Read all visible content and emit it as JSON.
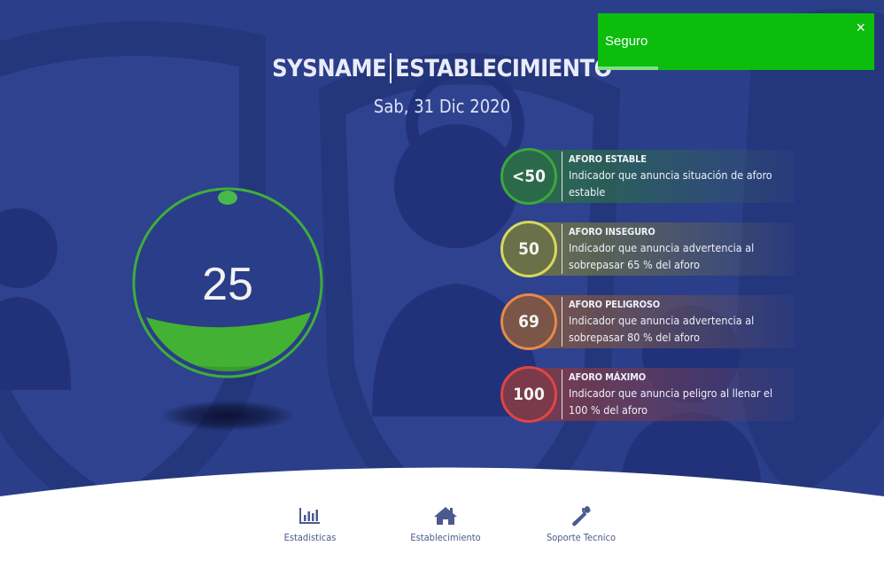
{
  "header": {
    "brand": "SYSNAME",
    "place": "ESTABLECIMIENTO",
    "date": "Sab, 31 Dic 2020"
  },
  "gauge": {
    "count": "25",
    "fill_level": 0.3,
    "ring_color": "#3fae3a",
    "fill_color": "#43b133"
  },
  "legend": [
    {
      "value": "<50",
      "title": "AFORO ESTABLE",
      "desc": "Indicador que anuncia situación de aforo estable",
      "color": "#3aa83a",
      "bg": "#2a6a4a"
    },
    {
      "value": "50",
      "title": "AFORO INSEGURO",
      "desc": "Indicador que anuncia advertencia al sobrepasar 65 % del aforo",
      "color": "#d7d95a",
      "bg": "#6a7048"
    },
    {
      "value": "69",
      "title": "AFORO PELIGROSO",
      "desc": "Indicador que anuncia advertencia al sobrepasar 80 % del aforo",
      "color": "#e8894a",
      "bg": "#7a5548"
    },
    {
      "value": "100",
      "title": "AFORO MÁXIMO",
      "desc": "Indicador que anuncia peligro al llenar el 100 % del aforo",
      "color": "#e04545",
      "bg": "#7a3a4a"
    }
  ],
  "toast": {
    "message": "Seguro",
    "close": "×",
    "color": "#0cbd0c"
  },
  "nav": [
    {
      "label": "Estadisticas",
      "icon": "bar-chart-icon"
    },
    {
      "label": "Establecimiento",
      "icon": "home-icon"
    },
    {
      "label": "Soporte Tecnico",
      "icon": "wrench-icon"
    }
  ]
}
